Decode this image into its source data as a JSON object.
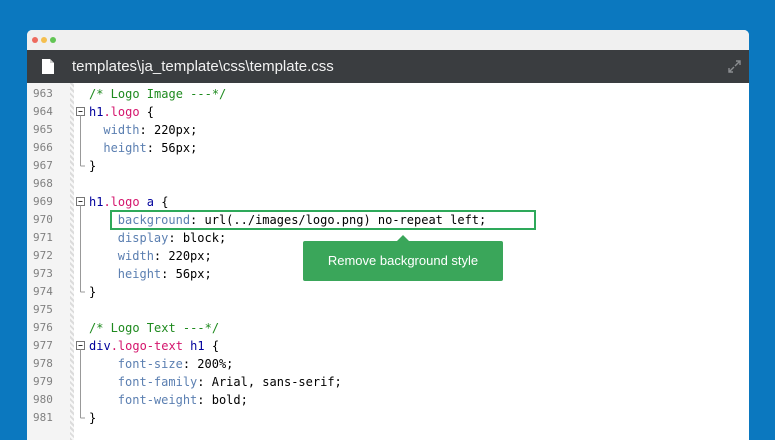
{
  "window": {
    "file_path": "templates\\ja_template\\css\\template.css"
  },
  "lines": [
    {
      "n": "963",
      "tokens": [
        {
          "t": "/* Logo Image ---*/",
          "c": "c-comment"
        }
      ],
      "indent": 0,
      "fold": "none"
    },
    {
      "n": "964",
      "tokens": [
        {
          "t": "h1",
          "c": "c-tag"
        },
        {
          "t": ".logo",
          "c": "c-class"
        },
        {
          "t": " {",
          "c": "c-val"
        }
      ],
      "indent": 0,
      "fold": "open"
    },
    {
      "n": "965",
      "tokens": [
        {
          "t": "width",
          "c": "c-prop"
        },
        {
          "t": ": 220px;",
          "c": "c-val"
        }
      ],
      "indent": 2,
      "fold": "line"
    },
    {
      "n": "966",
      "tokens": [
        {
          "t": "height",
          "c": "c-prop"
        },
        {
          "t": ": 56px;",
          "c": "c-val"
        }
      ],
      "indent": 2,
      "fold": "line"
    },
    {
      "n": "967",
      "tokens": [
        {
          "t": "}",
          "c": "c-val"
        }
      ],
      "indent": 0,
      "fold": "end"
    },
    {
      "n": "968",
      "tokens": [],
      "indent": 0,
      "fold": "none"
    },
    {
      "n": "969",
      "tokens": [
        {
          "t": "h1",
          "c": "c-tag"
        },
        {
          "t": ".logo",
          "c": "c-class"
        },
        {
          "t": " a",
          "c": "c-tag"
        },
        {
          "t": " {",
          "c": "c-val"
        }
      ],
      "indent": 0,
      "fold": "open"
    },
    {
      "n": "970",
      "tokens": [
        {
          "t": "background",
          "c": "c-prop"
        },
        {
          "t": ": url(../images/logo.png) no-repeat left;",
          "c": "c-val"
        }
      ],
      "indent": 4,
      "fold": "line"
    },
    {
      "n": "971",
      "tokens": [
        {
          "t": "display",
          "c": "c-prop"
        },
        {
          "t": ": block;",
          "c": "c-val"
        }
      ],
      "indent": 4,
      "fold": "line"
    },
    {
      "n": "972",
      "tokens": [
        {
          "t": "width",
          "c": "c-prop"
        },
        {
          "t": ": 220px;",
          "c": "c-val"
        }
      ],
      "indent": 4,
      "fold": "line"
    },
    {
      "n": "973",
      "tokens": [
        {
          "t": "height",
          "c": "c-prop"
        },
        {
          "t": ": 56px;",
          "c": "c-val"
        }
      ],
      "indent": 4,
      "fold": "line"
    },
    {
      "n": "974",
      "tokens": [
        {
          "t": "}",
          "c": "c-val"
        }
      ],
      "indent": 0,
      "fold": "end"
    },
    {
      "n": "975",
      "tokens": [],
      "indent": 0,
      "fold": "none"
    },
    {
      "n": "976",
      "tokens": [
        {
          "t": "/* Logo Text ---*/",
          "c": "c-comment"
        }
      ],
      "indent": 0,
      "fold": "none"
    },
    {
      "n": "977",
      "tokens": [
        {
          "t": "div",
          "c": "c-tag"
        },
        {
          "t": ".logo-text",
          "c": "c-class"
        },
        {
          "t": " h1",
          "c": "c-tag"
        },
        {
          "t": " {",
          "c": "c-val"
        }
      ],
      "indent": 0,
      "fold": "open"
    },
    {
      "n": "978",
      "tokens": [
        {
          "t": "font-size",
          "c": "c-prop"
        },
        {
          "t": ": 200%;",
          "c": "c-val"
        }
      ],
      "indent": 4,
      "fold": "line"
    },
    {
      "n": "979",
      "tokens": [
        {
          "t": "font-family",
          "c": "c-prop"
        },
        {
          "t": ": Arial, sans-serif;",
          "c": "c-val"
        }
      ],
      "indent": 4,
      "fold": "line"
    },
    {
      "n": "980",
      "tokens": [
        {
          "t": "font-weight",
          "c": "c-prop"
        },
        {
          "t": ": bold;",
          "c": "c-val"
        }
      ],
      "indent": 4,
      "fold": "line"
    },
    {
      "n": "981",
      "tokens": [
        {
          "t": "}",
          "c": "c-val"
        }
      ],
      "indent": 0,
      "fold": "end"
    }
  ],
  "tooltip": {
    "text": "Remove background style"
  },
  "icons": {
    "file": "file-icon",
    "expand": "expand-icon"
  },
  "colors": {
    "background": "#0b78bf",
    "highlight": "#2ea95a",
    "tab_bar": "#3a3d40"
  }
}
